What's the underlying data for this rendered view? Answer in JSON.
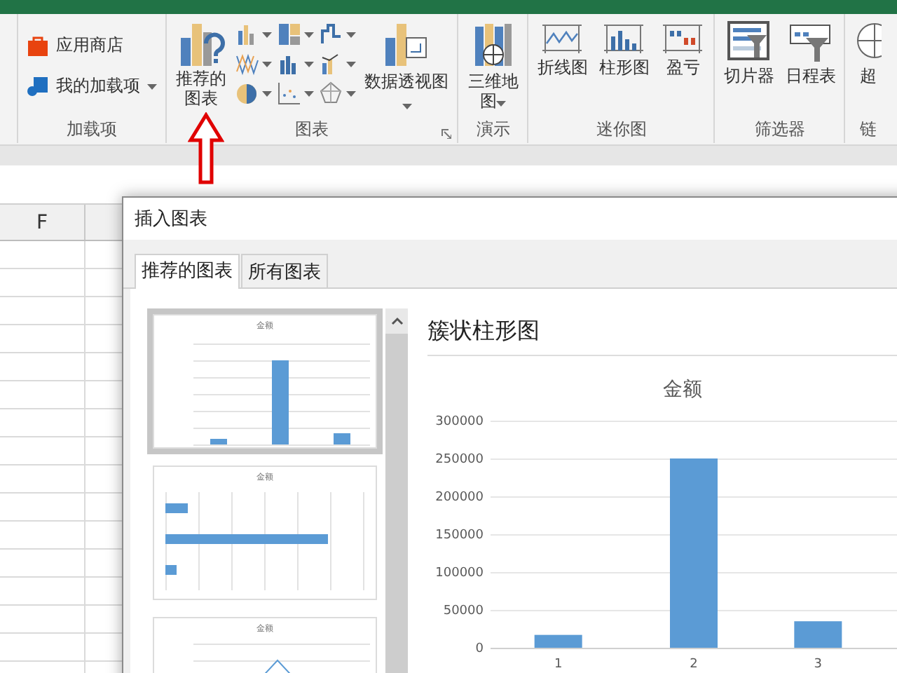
{
  "ribbon": {
    "groups": [
      {
        "kind": "addins",
        "label": "加载项",
        "items": [
          {
            "kind": "store",
            "label": "应用商店"
          },
          {
            "kind": "myaddins",
            "label": "我的加载项"
          }
        ]
      },
      {
        "kind": "charts",
        "label": "图表",
        "items": [
          {
            "kind": "recommended",
            "label": "推荐的图表"
          },
          {
            "kind": "gallery"
          },
          {
            "kind": "pivotchart",
            "label": "数据透视图"
          }
        ]
      },
      {
        "kind": "tours",
        "label": "演示",
        "items": [
          {
            "kind": "map3d",
            "label": "三维地图"
          }
        ]
      },
      {
        "kind": "sparklines",
        "label": "迷你图",
        "items": [
          {
            "kind": "sparkline",
            "label": "折线图"
          },
          {
            "kind": "sparkcolumn",
            "label": "柱形图"
          },
          {
            "kind": "winloss",
            "label": "盈亏"
          }
        ]
      },
      {
        "kind": "filters",
        "label": "筛选器",
        "items": [
          {
            "kind": "slicer",
            "label": "切片器"
          },
          {
            "kind": "timeline",
            "label": "日程表"
          }
        ]
      },
      {
        "kind": "links",
        "label": "链",
        "items": [
          {
            "kind": "link",
            "label": "超"
          }
        ]
      }
    ]
  },
  "sheet": {
    "columns": [
      "F"
    ]
  },
  "dialog": {
    "title": "插入图表",
    "tabs": [
      {
        "label": "推荐的图表",
        "selected": true
      },
      {
        "label": "所有图表",
        "selected": false
      }
    ],
    "thumbnails": [
      {
        "kind": "column",
        "title": "金额",
        "selected": true
      },
      {
        "kind": "bar",
        "title": "金额",
        "selected": false
      },
      {
        "kind": "line",
        "title": "金额",
        "selected": false
      }
    ],
    "preview": {
      "name": "簇状柱形图",
      "chart_data": {
        "type": "bar",
        "title": "金额",
        "categories": [
          "1",
          "2",
          "3"
        ],
        "values": [
          17000,
          250000,
          35000
        ],
        "ylim": [
          0,
          300000
        ],
        "yticks": [
          0,
          50000,
          100000,
          150000,
          200000,
          250000,
          300000
        ]
      }
    }
  }
}
